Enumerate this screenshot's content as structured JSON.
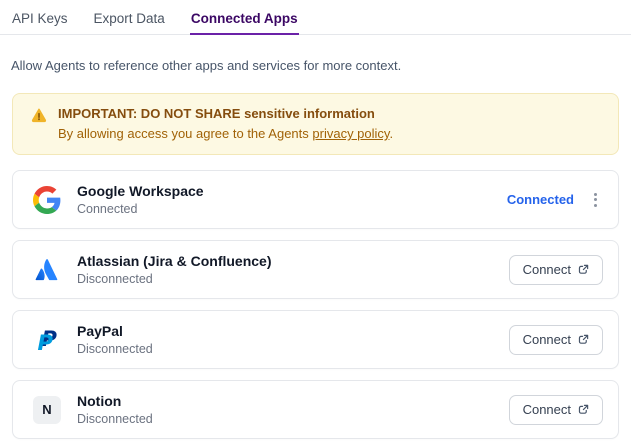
{
  "tabs": {
    "items": [
      {
        "label": "API Keys"
      },
      {
        "label": "Export Data"
      },
      {
        "label": "Connected Apps"
      }
    ],
    "active_tab": "Connected Apps"
  },
  "description": "Allow Agents to reference other apps and services for more context.",
  "warning": {
    "title": "IMPORTANT: DO NOT SHARE sensitive information",
    "body_prefix": "By allowing access you agree to the Agents ",
    "link_text": "privacy policy",
    "body_suffix": "."
  },
  "apps": [
    {
      "name": "Google Workspace",
      "status": "Connected",
      "icon": "google-logo",
      "action": "Connected",
      "has_menu": true
    },
    {
      "name": "Atlassian (Jira & Confluence)",
      "status": "Disconnected",
      "icon": "atlassian-logo",
      "action": "Connect"
    },
    {
      "name": "PayPal",
      "status": "Disconnected",
      "icon": "paypal-logo",
      "action": "Connect"
    },
    {
      "name": "Notion",
      "status": "Disconnected",
      "icon": "notion-letter-tile",
      "icon_letter": "N",
      "action": "Connect"
    }
  ],
  "colors": {
    "active_tab_underline": "#6b21a8",
    "active_tab_text": "#3b0764",
    "inactive_tab_text": "#4b5563",
    "warning_background": "#fdf9e3",
    "warning_border": "#f3e8b8",
    "warning_title_text": "#854d0e",
    "warning_body_text": "#a16207",
    "connected_link": "#2563eb",
    "card_border": "#e5e7eb",
    "app_name_text": "#111827",
    "app_status_text": "#6b7280"
  }
}
